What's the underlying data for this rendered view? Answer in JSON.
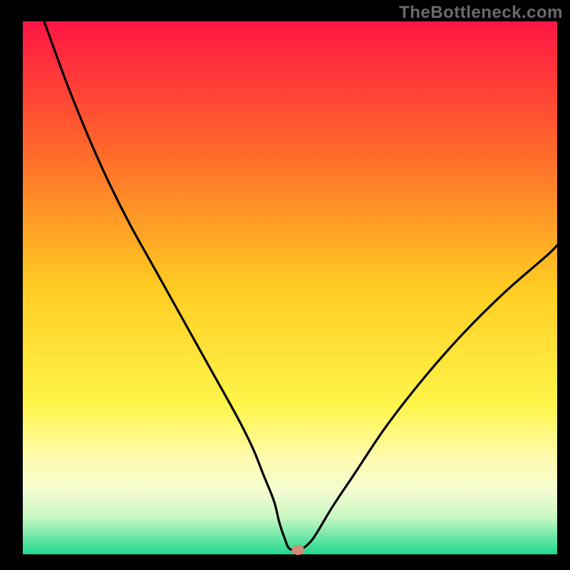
{
  "watermark": "TheBottleneck.com",
  "chart_data": {
    "type": "line",
    "title": "",
    "xlabel": "",
    "ylabel": "",
    "xlim": [
      0,
      100
    ],
    "ylim": [
      0,
      100
    ],
    "grid": false,
    "legend": false,
    "annotations": [],
    "background_gradient_stops": [
      {
        "offset": 0,
        "color": "#ff1544"
      },
      {
        "offset": 25,
        "color": "#ff6b2a"
      },
      {
        "offset": 50,
        "color": "#ffcc22"
      },
      {
        "offset": 72,
        "color": "#fff54a"
      },
      {
        "offset": 82,
        "color": "#fffbaf"
      },
      {
        "offset": 88,
        "color": "#f4fdd2"
      },
      {
        "offset": 93,
        "color": "#c9f7c3"
      },
      {
        "offset": 100,
        "color": "#1fd890"
      }
    ],
    "series": [
      {
        "name": "bottleneck-curve",
        "x": [
          4,
          8,
          12,
          16,
          20,
          25,
          30,
          35,
          40,
          43,
          45,
          47,
          48,
          49,
          50,
          52,
          53.5,
          55,
          58,
          62,
          68,
          75,
          82,
          90,
          98,
          100
        ],
        "values": [
          100,
          89,
          79,
          70,
          62,
          53,
          44,
          35,
          26,
          20,
          15,
          10,
          6,
          3,
          1,
          1,
          2,
          4,
          9,
          15,
          24,
          33,
          41,
          49,
          56,
          58
        ]
      }
    ],
    "marker": {
      "name": "highlight-point",
      "x": 51.5,
      "y": 0.8,
      "color": "#d08a76"
    }
  }
}
